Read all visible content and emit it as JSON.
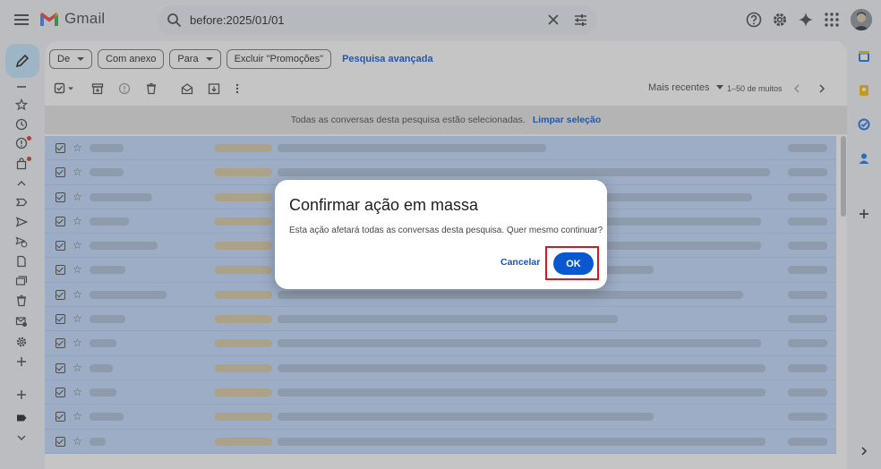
{
  "app": {
    "name": "Gmail"
  },
  "search": {
    "query": "before:2025/01/01"
  },
  "filters": {
    "chips": [
      {
        "label": "De",
        "dropdown": true
      },
      {
        "label": "Com anexo",
        "dropdown": false
      },
      {
        "label": "Para",
        "dropdown": true
      },
      {
        "label": "Excluir \"Promoções\"",
        "dropdown": false
      }
    ],
    "advanced_search": "Pesquisa avançada"
  },
  "toolbar": {
    "sort_label": "Mais recentes",
    "count_label": "1–50 de muitos"
  },
  "banner": {
    "message": "Todas as conversas desta pesquisa estão selecionadas.",
    "clear_link": "Limpar seleção"
  },
  "dialog": {
    "title": "Confirmar ação em massa",
    "message": "Esta ação afetará todas as conversas desta pesquisa. Quer mesmo continuar?",
    "cancel_label": "Cancelar",
    "ok_label": "OK"
  },
  "colors": {
    "accent": "#0b57d0",
    "compose_bg": "#c2e7ff",
    "selected_row": "#c2dbff",
    "highlight_frame": "#d5191f"
  }
}
